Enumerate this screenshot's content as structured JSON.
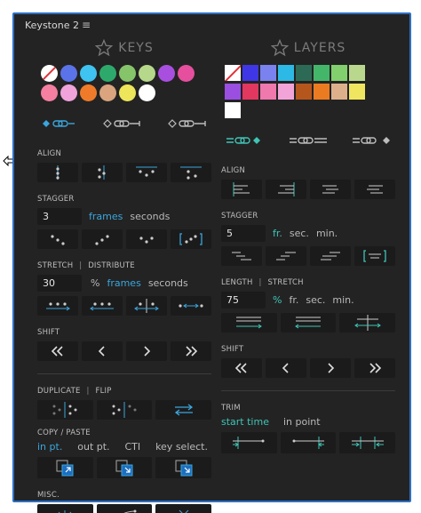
{
  "panel": {
    "title": "Keystone 2",
    "menu_icon": "hamburger-icon"
  },
  "keys": {
    "header": "KEYS",
    "swatches": [
      "none",
      "#5b73e8",
      "#3fc3f0",
      "#2daa6b",
      "#86c46a",
      "#b6d88a",
      "#a84fe0",
      "#e64f9e",
      "#f57fa0",
      "#f0a3da",
      "#ef7b2a",
      "#d9a47e",
      "#ede55a",
      "#ffffff"
    ],
    "selector": [
      "in-point",
      "mid",
      "out-point"
    ],
    "align_label": "ALIGN",
    "stagger_label": "STAGGER",
    "stagger_value": "3",
    "stagger_units": [
      "frames",
      "seconds"
    ],
    "stretch_label": "STRETCH",
    "distribute_label": "DISTRIBUTE",
    "stretch_value": "30",
    "stretch_units": [
      "%",
      "frames",
      "seconds"
    ],
    "shift_label": "SHIFT",
    "duplicate_label": "DUPLICATE",
    "flip_label": "FLIP",
    "copy_paste_label": "COPY / PASTE",
    "paste_modes": [
      "in pt.",
      "out pt.",
      "CTI",
      "key select."
    ],
    "misc_label": "MISC.",
    "separator": "|"
  },
  "layers": {
    "header": "LAYERS",
    "swatches": [
      "none",
      "#3f37e6",
      "#7a82ef",
      "#2cb9e6",
      "#2d6a55",
      "#44b66a",
      "#82cf6e",
      "#bad88d",
      "#9a4fe0",
      "#e2375f",
      "#ef78ad",
      "#f2a4d9",
      "#b5561c",
      "#eb7b21",
      "#ddb08b",
      "#f0e55f",
      "#ffffff"
    ],
    "align_label": "ALIGN",
    "stagger_label": "STAGGER",
    "stagger_value": "5",
    "stagger_units": [
      "fr.",
      "sec.",
      "min."
    ],
    "length_label": "LENGTH",
    "stretch_label": "STRETCH",
    "length_value": "75",
    "length_units": [
      "%",
      "fr.",
      "sec.",
      "min."
    ],
    "shift_label": "SHIFT",
    "trim_label": "TRIM",
    "trim_modes": [
      "start time",
      "in point"
    ],
    "separator": "|"
  },
  "colors": {
    "accent_blue": "#3aa6dd",
    "accent_teal": "#3fc4b6",
    "panel_bg": "#232323",
    "border": "#2d6fc4"
  }
}
